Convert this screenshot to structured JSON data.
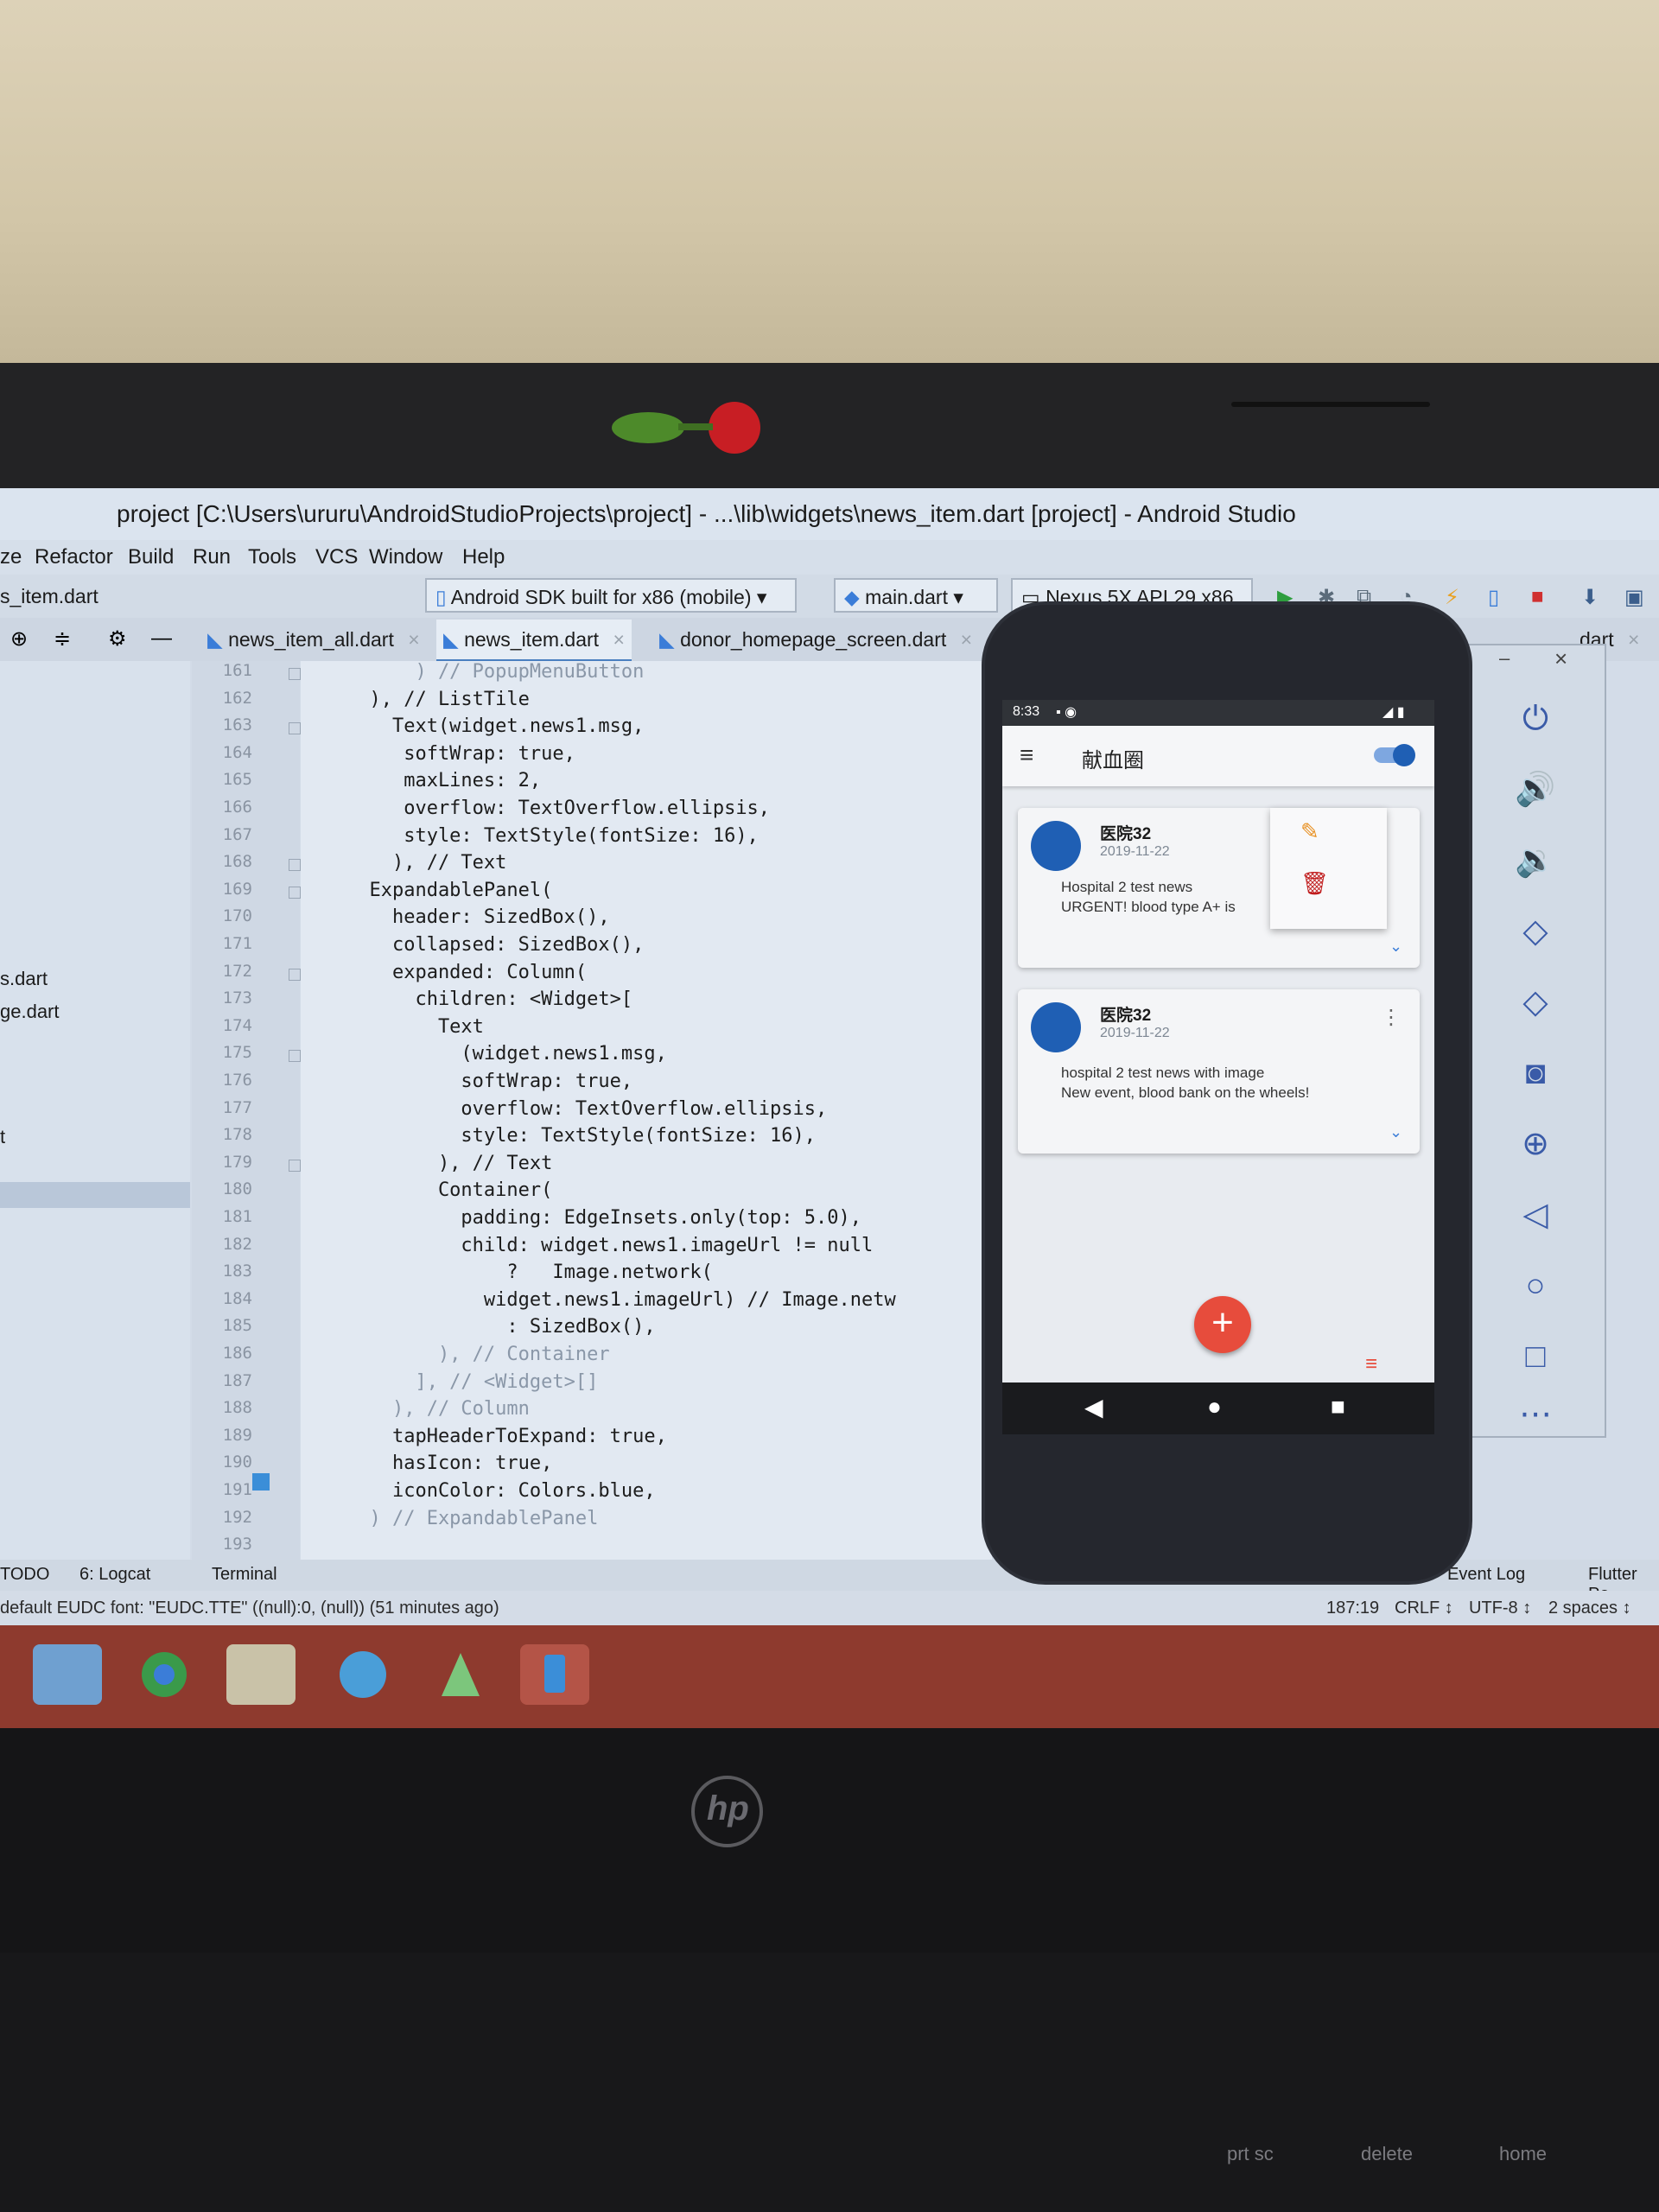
{
  "window": {
    "title": "project [C:\\Users\\ururu\\AndroidStudioProjects\\project] - ...\\lib\\widgets\\news_item.dart [project] - Android Studio"
  },
  "menu": [
    "ze",
    "Refactor",
    "Build",
    "Run",
    "Tools",
    "VCS",
    "Window",
    "Help"
  ],
  "toolbar": {
    "current_file": "s_item.dart",
    "sdk_combo": "Android SDK built for x86 (mobile)",
    "run_config": "main.dart",
    "device_combo": "Nexus 5X API 29 x86"
  },
  "tabs": [
    {
      "label": "news_item_all.dart",
      "active": false
    },
    {
      "label": "news_item.dart",
      "active": true
    },
    {
      "label": "donor_homepage_screen.dart",
      "active": false
    },
    {
      "label": "dart",
      "active": false
    }
  ],
  "project_pane": {
    "files": [
      "s.dart",
      "ge.dart",
      "t"
    ]
  },
  "editor": {
    "lines": [
      {
        "n": "161",
        "text": "          ) // PopupMenuButton",
        "cls": "comment"
      },
      {
        "n": "162",
        "text": "      ), // ListTile",
        "cls": "plain"
      },
      {
        "n": "163",
        "text": "        Text(widget.news1.msg,",
        "cls": "plain"
      },
      {
        "n": "164",
        "text": "         softWrap: true,",
        "cls": "plain"
      },
      {
        "n": "165",
        "text": "         maxLines: 2,",
        "cls": "plain"
      },
      {
        "n": "166",
        "text": "         overflow: TextOverflow.ellipsis,",
        "cls": "plain"
      },
      {
        "n": "167",
        "text": "         style: TextStyle(fontSize: 16),",
        "cls": "plain"
      },
      {
        "n": "168",
        "text": "        ), // Text",
        "cls": "plain"
      },
      {
        "n": "169",
        "text": "      ExpandablePanel(",
        "cls": "plain"
      },
      {
        "n": "170",
        "text": "        header: SizedBox(),",
        "cls": "plain"
      },
      {
        "n": "171",
        "text": "        collapsed: SizedBox(),",
        "cls": "plain"
      },
      {
        "n": "172",
        "text": "        expanded: Column(",
        "cls": "plain"
      },
      {
        "n": "173",
        "text": "          children: <Widget>[",
        "cls": "plain"
      },
      {
        "n": "174",
        "text": "            Text",
        "cls": "plain"
      },
      {
        "n": "175",
        "text": "              (widget.news1.msg,",
        "cls": "plain"
      },
      {
        "n": "176",
        "text": "              softWrap: true,",
        "cls": "plain"
      },
      {
        "n": "177",
        "text": "              overflow: TextOverflow.ellipsis,",
        "cls": "plain"
      },
      {
        "n": "178",
        "text": "              style: TextStyle(fontSize: 16),",
        "cls": "plain"
      },
      {
        "n": "179",
        "text": "            ), // Text",
        "cls": "plain"
      },
      {
        "n": "180",
        "text": "            Container(",
        "cls": "plain"
      },
      {
        "n": "181",
        "text": "              padding: EdgeInsets.only(top: 5.0),",
        "cls": "plain"
      },
      {
        "n": "182",
        "text": "              child: widget.news1.imageUrl != null",
        "cls": "plain"
      },
      {
        "n": "183",
        "text": "                  ?   Image.network(",
        "cls": "plain"
      },
      {
        "n": "184",
        "text": "                widget.news1.imageUrl) // Image.netw",
        "cls": "plain"
      },
      {
        "n": "185",
        "text": "                  : SizedBox(),",
        "cls": "plain"
      },
      {
        "n": "186",
        "text": "            ), // Container",
        "cls": "comment"
      },
      {
        "n": "187",
        "text": "          ], // <Widget>[]",
        "cls": "comment"
      },
      {
        "n": "188",
        "text": "        ), // Column",
        "cls": "comment"
      },
      {
        "n": "189",
        "text": "        tapHeaderToExpand: true,",
        "cls": "plain"
      },
      {
        "n": "190",
        "text": "        hasIcon: true,",
        "cls": "plain"
      },
      {
        "n": "191",
        "text": "        iconColor: Colors.blue,",
        "cls": "plain"
      },
      {
        "n": "192",
        "text": "      ) // ExpandablePanel",
        "cls": "comment"
      },
      {
        "n": "193",
        "text": "",
        "cls": "plain"
      }
    ]
  },
  "toolwindows": {
    "todo": "TODO",
    "logcat": "6: Logcat",
    "terminal": "Terminal",
    "event_log": "Event Log",
    "flutter": "Flutter Pe"
  },
  "status": {
    "message": "default EUDC font: \"EUDC.TTE\" ((null):0, (null)) (51 minutes ago)",
    "position": "187:19",
    "line_sep": "CRLF ↕",
    "encoding": "UTF-8 ↕",
    "indent": "2 spaces ↕"
  },
  "phone": {
    "time": "8:33",
    "app_title": "献血圈",
    "cards": [
      {
        "title": "医院32",
        "date": "2019-11-22",
        "line1": "Hospital 2 test news",
        "line2": "URGENT! blood type A+ is"
      },
      {
        "title": "医院32",
        "date": "2019-11-22",
        "line1": "hospital 2 test news with image",
        "line2": "New event, blood bank on the wheels!"
      }
    ],
    "fab_label": "+"
  },
  "keyboard": [
    "prt sc",
    "delete",
    "home"
  ],
  "colors": {
    "accent_blue": "#1f5fb4",
    "fab_red": "#e74c3c",
    "taskbar": "#8e3a2e"
  }
}
